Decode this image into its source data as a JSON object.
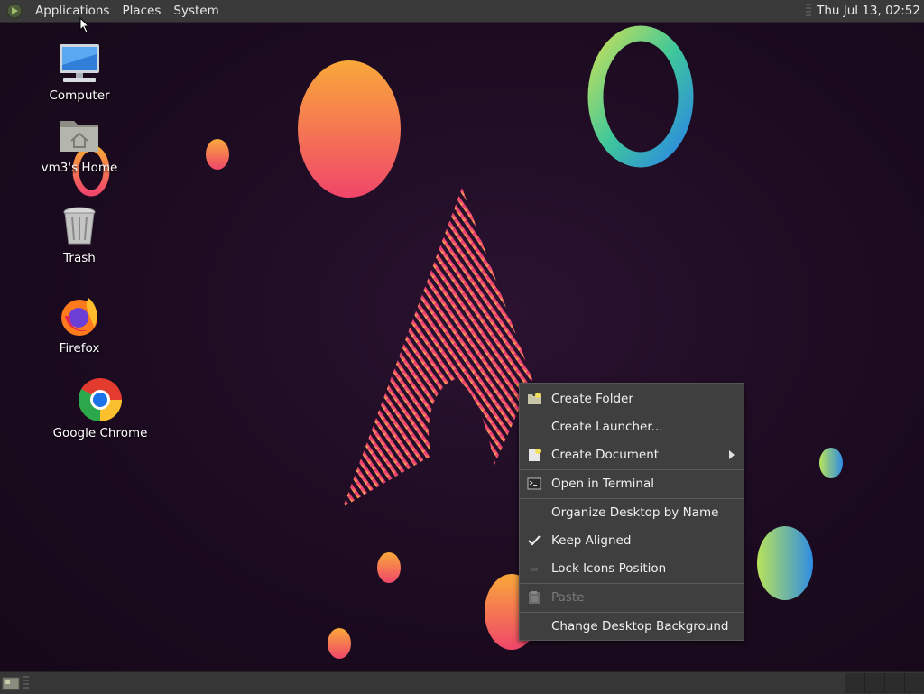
{
  "top_panel": {
    "menus": [
      "Applications",
      "Places",
      "System"
    ],
    "clock": "Thu Jul 13, 02:52"
  },
  "desktop_icons": [
    {
      "label": "Computer",
      "icon": "computer-icon"
    },
    {
      "label": "vm3's Home",
      "icon": "home-folder-icon"
    },
    {
      "label": "Trash",
      "icon": "trash-icon"
    },
    {
      "label": "Firefox",
      "icon": "firefox-icon"
    },
    {
      "label": "Google Chrome",
      "icon": "chrome-icon"
    }
  ],
  "context_menu": {
    "items": [
      {
        "label": "Create Folder",
        "icon": "folder-new-icon",
        "enabled": true
      },
      {
        "label": "Create Launcher...",
        "icon": "",
        "enabled": true
      },
      {
        "label": "Create Document",
        "icon": "document-new-icon",
        "enabled": true,
        "submenu": true
      },
      {
        "label": "Open in Terminal",
        "icon": "terminal-icon",
        "enabled": true
      },
      {
        "label": "Organize Desktop by Name",
        "icon": "",
        "enabled": true
      },
      {
        "label": "Keep Aligned",
        "icon": "checkmark-icon",
        "enabled": true,
        "checked": true
      },
      {
        "label": "Lock Icons Position",
        "icon": "",
        "enabled": true
      },
      {
        "label": "Paste",
        "icon": "paste-icon",
        "enabled": false
      },
      {
        "label": "Change Desktop Background",
        "icon": "",
        "enabled": true
      }
    ]
  },
  "colors": {
    "panel_bg": "#3a3a3a",
    "menu_bg": "#3f3f3f",
    "desktop_bg": "#1c0b20",
    "accent_pink": "#e8336b",
    "accent_orange": "#f7a13b"
  }
}
